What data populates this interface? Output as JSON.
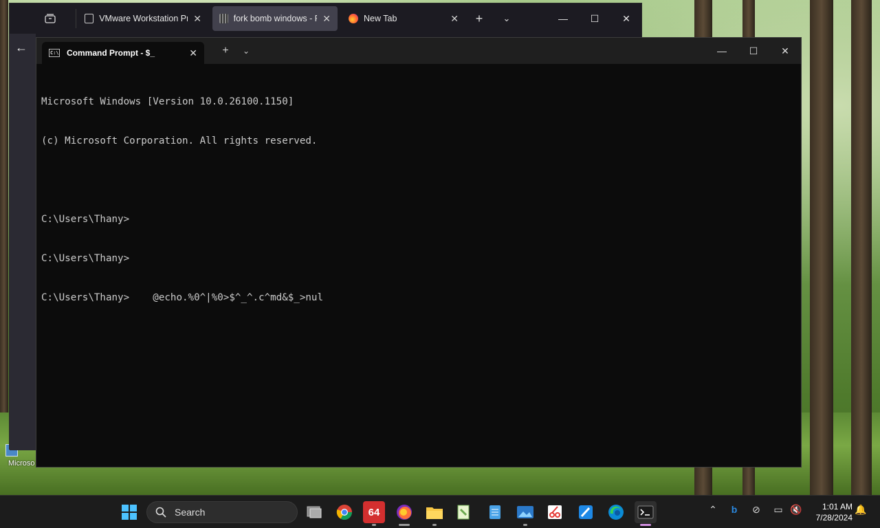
{
  "browser": {
    "tabs": [
      {
        "title": "VMware Workstation Pro",
        "favicon": "vmware-icon"
      },
      {
        "title": "fork bomb windows - Pa",
        "favicon": "page-icon",
        "active": true
      },
      {
        "title": "New Tab",
        "favicon": "firefox-icon"
      }
    ]
  },
  "terminal": {
    "tab_title": "Command Prompt - $_",
    "lines": [
      "Microsoft Windows [Version 10.0.26100.1150]",
      "(c) Microsoft Corporation. All rights reserved.",
      "",
      "C:\\Users\\Thany>",
      "C:\\Users\\Thany>",
      "C:\\Users\\Thany>    @echo.%0^|%0>$^_^.c^md&$_>nul"
    ]
  },
  "desktop": {
    "icon_label": "Microso"
  },
  "taskbar": {
    "search_placeholder": "Search",
    "apps": [
      "task-view",
      "chrome",
      "hwinfo64",
      "firefox",
      "file-explorer",
      "notepadpp",
      "notepad",
      "photos",
      "snipping-tool",
      "paint",
      "edge",
      "terminal"
    ],
    "hwinfo_label": "64",
    "time": "1:01 AM",
    "date": "7/28/2024"
  },
  "colors": {
    "terminal_bg": "#0c0c0c",
    "terminal_text": "#cccccc",
    "taskbar_bg": "#1c1c1c",
    "accent": "#d18fe0"
  }
}
